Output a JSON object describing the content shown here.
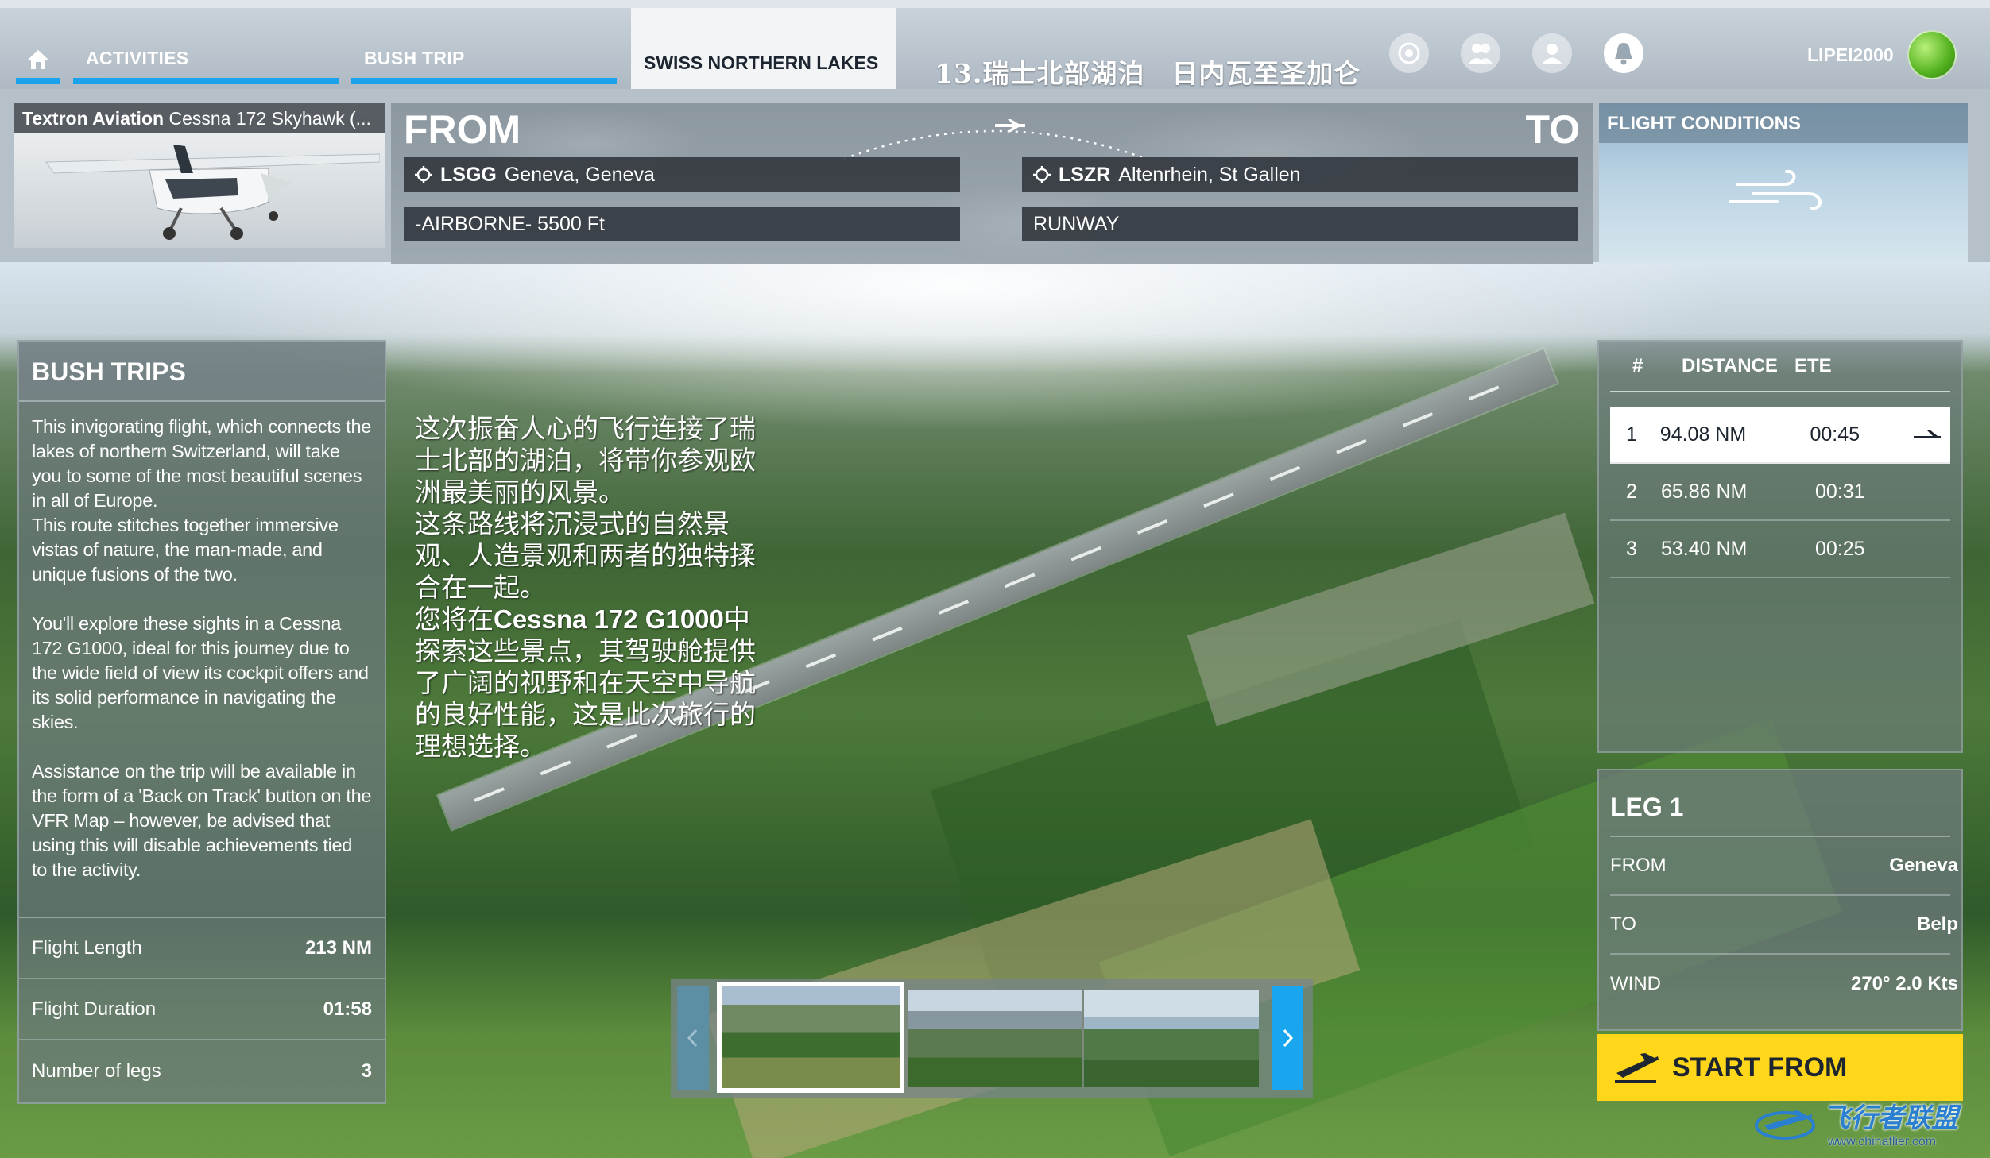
{
  "nav": {
    "activities_label": "ACTIVITIES",
    "bush_trip_label": "BUSH TRIP",
    "active_tab_label": "SWISS NORTHERN LAKES",
    "title_cn": "13.瑞士北部湖泊　日内瓦至圣加仑",
    "username": "LIPEI2000"
  },
  "aircraft": {
    "maker": "Textron Aviation",
    "model": "Cessna 172 Skyhawk (..."
  },
  "route": {
    "from_label": "FROM",
    "to_label": "TO",
    "from_icao": "LSGG",
    "from_name": "Geneva, Geneva",
    "to_icao": "LSZR",
    "to_name": "Altenrhein, St Gallen",
    "from_state": "-AIRBORNE- 5500 Ft",
    "to_state": "RUNWAY"
  },
  "conditions": {
    "title": "FLIGHT CONDITIONS"
  },
  "bush_trips": {
    "title": "BUSH TRIPS",
    "desc_p1a": "This invigorating flight, which connects the lakes of northern Switzerland, will take you to some of the most beautiful scenes in all of Europe.",
    "desc_p1b": "This route stitches together immersive vistas of nature, the man-made, and unique fusions of the two.",
    "desc_p2": "You'll explore these sights in a Cessna 172 G1000, ideal for this journey due to the wide field of view its cockpit offers and its solid performance in navigating the skies.",
    "desc_p3": "Assistance on the trip will be available in the form of a 'Back on Track' button on the VFR Map – however, be advised that using this will disable achievements tied to the activity.",
    "stats": [
      {
        "label": "Flight Length",
        "value": "213 NM"
      },
      {
        "label": "Flight Duration",
        "value": "01:58"
      },
      {
        "label": "Number of legs",
        "value": "3"
      }
    ]
  },
  "cn_overlay": {
    "line1": "这次振奋人心的飞行连接了瑞士北部的湖泊，将带你参观欧洲最美丽的风景。",
    "line2": "这条路线将沉浸式的自然景观、人造景观和两者的独特揉合在一起。",
    "line3_pre": "您将在",
    "line3_hl": "Cessna 172 G1000",
    "line3_post": "中探索这些景点，其驾驶舱提供了广阔的视野和在天空中导航的良好性能，这是此次旅行的理想选择。"
  },
  "legs": {
    "headers": {
      "num": "#",
      "distance": "DISTANCE",
      "ete": "ETE"
    },
    "rows": [
      {
        "num": "1",
        "distance": "94.08 NM",
        "ete": "00:45"
      },
      {
        "num": "2",
        "distance": "65.86 NM",
        "ete": "00:31"
      },
      {
        "num": "3",
        "distance": "53.40 NM",
        "ete": "00:25"
      }
    ]
  },
  "leg_detail": {
    "title": "LEG 1",
    "rows": [
      {
        "label": "FROM",
        "value": "Geneva"
      },
      {
        "label": "TO",
        "value": "Belp"
      },
      {
        "label": "WIND",
        "value": "270° 2.0 Kts"
      }
    ]
  },
  "start_button": {
    "label": "START FROM"
  },
  "watermark": {
    "cn": "飞行者联盟",
    "url": "www.chinaflier.com"
  },
  "colors": {
    "accent": "#1aa3ec",
    "start_button": "#ffd619"
  },
  "icons": {
    "home": "home-icon",
    "friends": "friends-icon",
    "profile": "profile-icon",
    "notifications": "bell-icon",
    "waypoint": "waypoint-icon",
    "plane": "plane-icon",
    "wind": "wind-icon"
  }
}
